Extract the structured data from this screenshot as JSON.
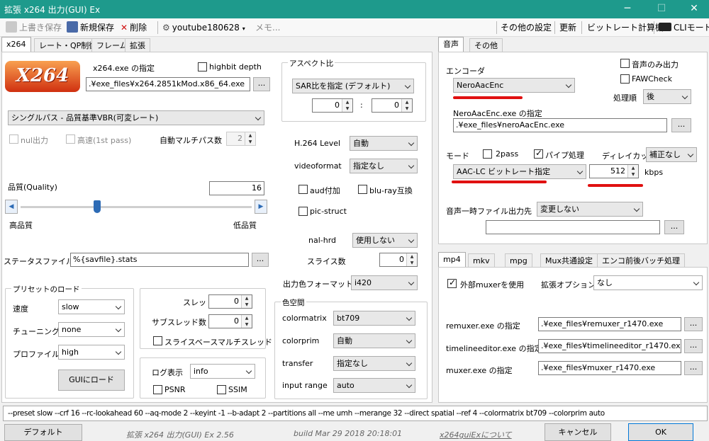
{
  "window": {
    "title": "拡張 x264 出力(GUI) Ex"
  },
  "toolbar": {
    "overwrite": "上書き保存",
    "new_save": "新規保存",
    "delete": "削除",
    "profile": "youtube180628",
    "memo": "メモ...",
    "other_settings": "その他の設定",
    "refresh": "更新",
    "bitrate_calc": "ビットレート計算機",
    "cli_mode": "CLIモード"
  },
  "left_tabs": [
    "x264",
    "レート・QP制御",
    "フレーム",
    "拡張"
  ],
  "x264": {
    "logo_text": "X264",
    "exe_label": "x264.exe の指定",
    "highbit_label": "highbit depth",
    "exe_path": ".¥exe_files¥x264.2851kMod.x86_64.exe",
    "browse": "...",
    "mode": "シングルパス - 品質基準VBR(可変レート)",
    "nul_output": "nul出力",
    "fast_first": "高速(1st pass)",
    "auto_multipass": "自動マルチパス数",
    "auto_multipass_value": "2",
    "quality_label": "品質(Quality)",
    "quality_value": "16",
    "quality_slider_fraction": 0.33,
    "high_quality": "高品質",
    "low_quality": "低品質",
    "stats_label": "ステータスファイル",
    "stats_value": "%{savfile}.stats",
    "preset_group": "プリセットのロード",
    "speed_label": "速度",
    "speed_value": "slow",
    "tune_label": "チューニング",
    "tune_value": "none",
    "profile_label": "プロファイル",
    "profile_value": "high",
    "gui_load": "GUIにロード",
    "threads_label": "スレッド数",
    "threads_value": "0",
    "subthreads_label": "サブスレッド数",
    "subthreads_value": "0",
    "slice_mt": "スライスベースマルチスレッド",
    "log_label": "ログ表示",
    "log_value": "info",
    "psnr": "PSNR",
    "ssim": "SSIM",
    "aspect_group": "アスペクト比",
    "aspect_mode": "SAR比を指定 (デフォルト)",
    "aspect_x": "0",
    "aspect_y": "0",
    "aspect_sep": ":",
    "level_label": "H.264 Level",
    "level_value": "自動",
    "videoformat_label": "videoformat",
    "videoformat_value": "指定なし",
    "aud": "aud付加",
    "bluray": "blu-ray互換",
    "picstruct": "pic-struct",
    "nalhrd_label": "nal-hrd",
    "nalhrd_value": "使用しない",
    "slices_label": "スライス数",
    "slices_value": "0",
    "csp_label": "出力色フォーマット",
    "csp_value": "i420",
    "colorspace_group": "色空間",
    "colormatrix_label": "colormatrix",
    "colormatrix_value": "bt709",
    "colorprim_label": "colorprim",
    "colorprim_value": "自動",
    "transfer_label": "transfer",
    "transfer_value": "指定なし",
    "range_label": "input range",
    "range_value": "auto"
  },
  "audio_tabs": [
    "音声",
    "その他"
  ],
  "audio": {
    "encoder_label": "エンコーダ",
    "encoder_value": "NeroAacEnc",
    "audio_only": "音声のみ出力",
    "fawcheck": "FAWCheck",
    "order_label": "処理順",
    "order_value": "後",
    "exe_label": "NeroAacEnc.exe の指定",
    "exe_path": ".¥exe_files¥neroAacEnc.exe",
    "mode_label": "モード",
    "twopass": "2pass",
    "pipe": "パイプ処理",
    "delay_label": "ディレイカット",
    "delay_value": "補正なし",
    "mode_value": "AAC-LC ビットレート指定",
    "bitrate_value": "512",
    "bitrate_unit": "kbps",
    "temp_label": "音声一時ファイル出力先",
    "temp_value": "変更しない",
    "temp_path": ""
  },
  "mux_tabs": [
    "mp4",
    "mkv",
    "mpg",
    "Mux共通設定",
    "エンコ前後バッチ処理"
  ],
  "mux": {
    "external": "外部muxerを使用",
    "ext_opt_label": "拡張オプション",
    "ext_opt_value": "なし",
    "remuxer_label": "remuxer.exe の指定",
    "remuxer_path": ".¥exe_files¥remuxer_r1470.exe",
    "timeline_label": "timelineeditor.exe の指定",
    "timeline_path": ".¥exe_files¥timelineeditor_r1470.exe",
    "muxer_label": "muxer.exe の指定",
    "muxer_path": ".¥exe_files¥muxer_r1470.exe"
  },
  "cmdline": "--preset slow --crf 16 --rc-lookahead 60 --aq-mode 2 --keyint -1 --b-adapt 2 --partitions all --me umh --merange 32 --direct spatial --ref 4 --colormatrix bt709 --colorprim auto",
  "footer": {
    "default": "デフォルト",
    "version": "拡張 x264 出力(GUI) Ex 2.56",
    "build": "build Mar 29 2018 20:18:01",
    "about": "x264guiExについて",
    "cancel": "キャンセル",
    "ok": "OK"
  },
  "colors": {
    "titlebar": "#1e9a8c",
    "accent_red": "#e01010"
  }
}
